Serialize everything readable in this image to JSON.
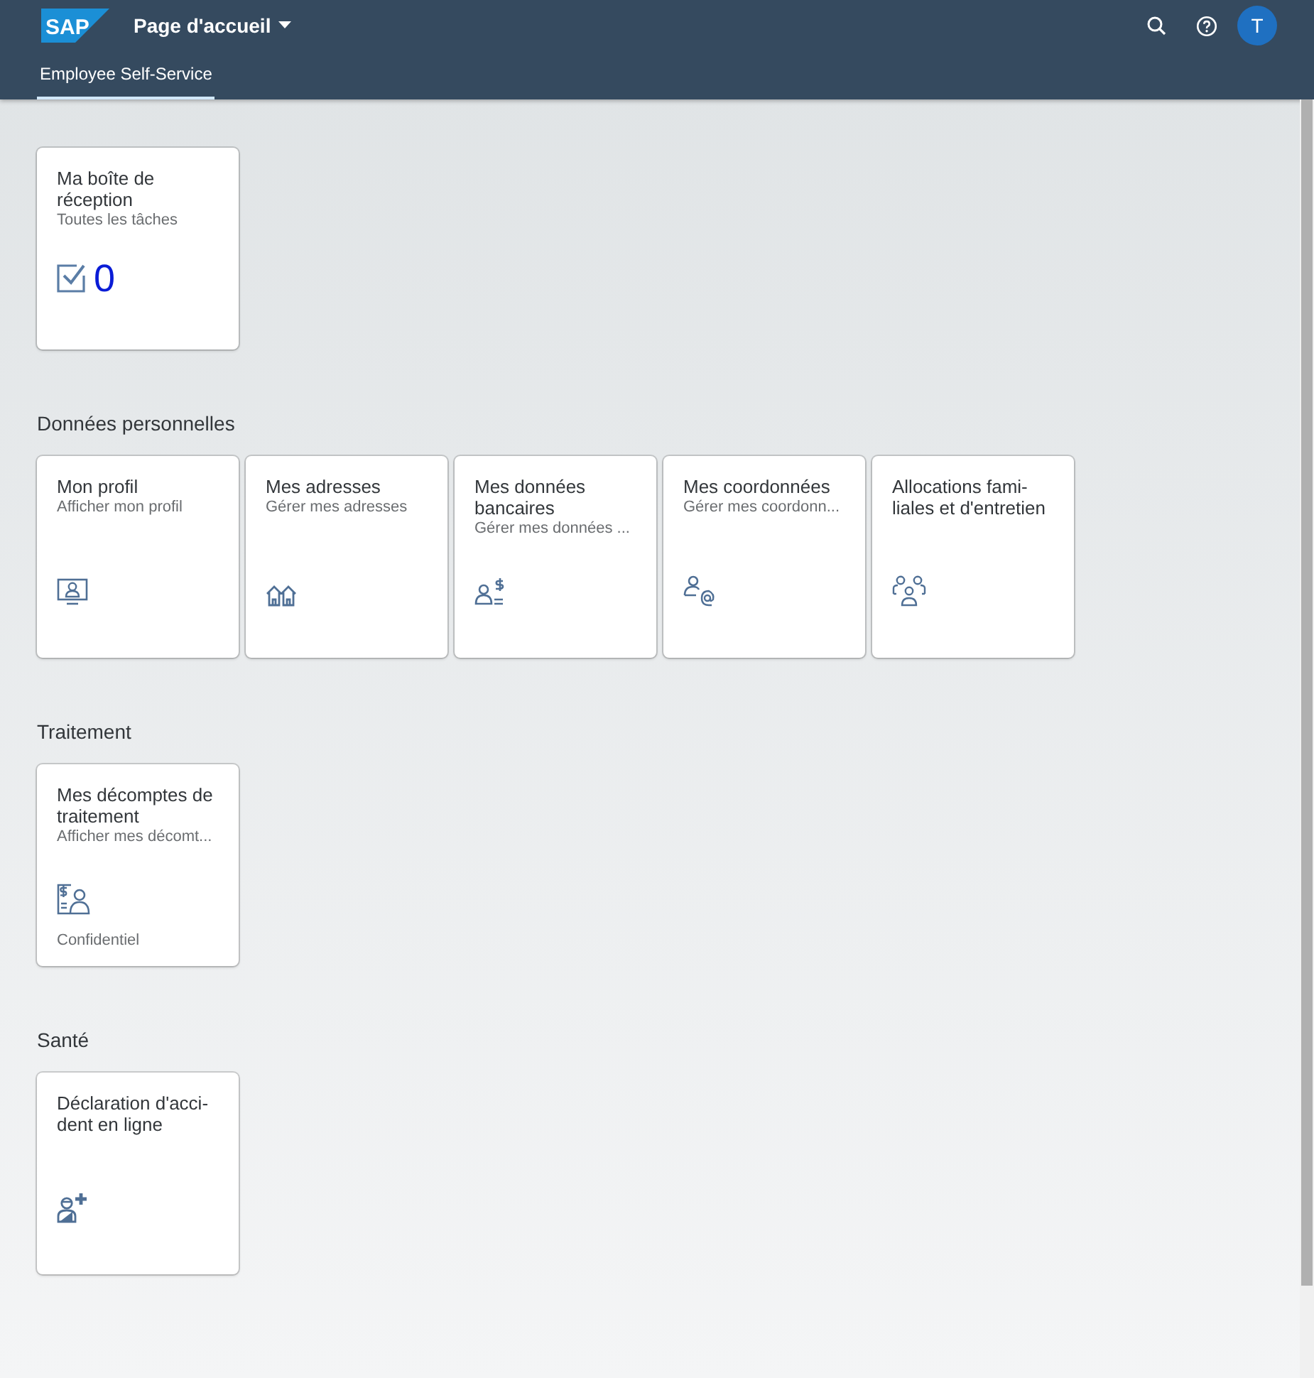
{
  "shell": {
    "logo": "SAP",
    "title": "Page d'accueil",
    "avatar": "T"
  },
  "tabs": [
    {
      "label": "Employee Self-Service",
      "selected": true
    }
  ],
  "groups": [
    {
      "tiles": [
        {
          "kind": "count",
          "title": "Ma boîte de\nréception",
          "subtitle": "Toutes les tâches",
          "number": "0"
        }
      ]
    },
    {
      "title": "Données personnelles",
      "tiles": [
        {
          "kind": "launch",
          "title": "Mon profil",
          "subtitle": "Afficher mon profil"
        },
        {
          "kind": "launch",
          "title": "Mes adresses",
          "subtitle": "Gérer mes adresses"
        },
        {
          "kind": "launch",
          "title": "Mes données\nbancaires",
          "subtitle": "Gérer mes données ..."
        },
        {
          "kind": "launch",
          "title": "Mes coordonnées",
          "subtitle": "Gérer mes coordonn..."
        },
        {
          "kind": "launch",
          "title": "Allocations fami-\nliales et d'entretien"
        }
      ]
    },
    {
      "title": "Traitement",
      "tiles": [
        {
          "kind": "launch",
          "title": "Mes décomptes de\ntraitement",
          "subtitle": "Afficher mes décomt...",
          "footer": "Confidentiel"
        }
      ]
    },
    {
      "title": "Santé",
      "tiles": [
        {
          "kind": "launch",
          "title": "Déclaration d'acci-\ndent en ligne"
        }
      ]
    }
  ]
}
